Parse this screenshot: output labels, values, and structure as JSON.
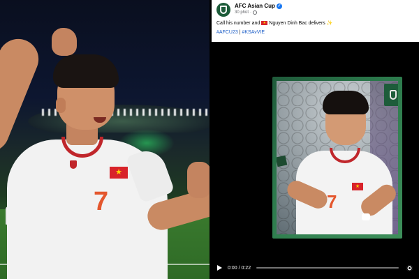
{
  "post": {
    "page_name": "AFC Asian Cup",
    "time_ago": "30 phút",
    "caption_before": "Call his number and",
    "caption_after": "Nguyen Dinh Bac delivers",
    "hashtag_1": "#AFCU23",
    "hashtag_separator": "|",
    "hashtag_2": "#KSAvVIE"
  },
  "video": {
    "time": "0:00 / 0:22",
    "progress": 0,
    "jersey_number": "7"
  },
  "colors": {
    "brand": "#1d5c3a",
    "link": "#1b5dc7",
    "jersey_accent": "#c0262b",
    "flag_red": "#d8232a",
    "flag_star": "#ffd400"
  },
  "icons": {
    "verified": "verified-badge-icon",
    "audience": "globe-icon",
    "flag": "vietnam-flag-icon",
    "sparkle": "sparkle-icon",
    "play": "play-icon",
    "settings": "gear-icon"
  }
}
